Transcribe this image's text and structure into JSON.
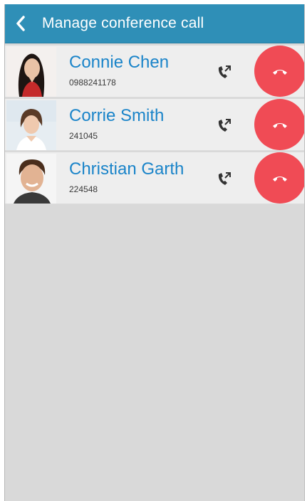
{
  "header": {
    "title": "Manage conference call"
  },
  "participants": [
    {
      "name": "Connie Chen",
      "number": "0988241178"
    },
    {
      "name": "Corrie Smith",
      "number": "241045"
    },
    {
      "name": "Christian Garth",
      "number": "224548"
    }
  ],
  "colors": {
    "appbar": "#2f8fb7",
    "name_text": "#1a84c9",
    "end_call": "#f04b55",
    "background": "#d9d9d9"
  }
}
